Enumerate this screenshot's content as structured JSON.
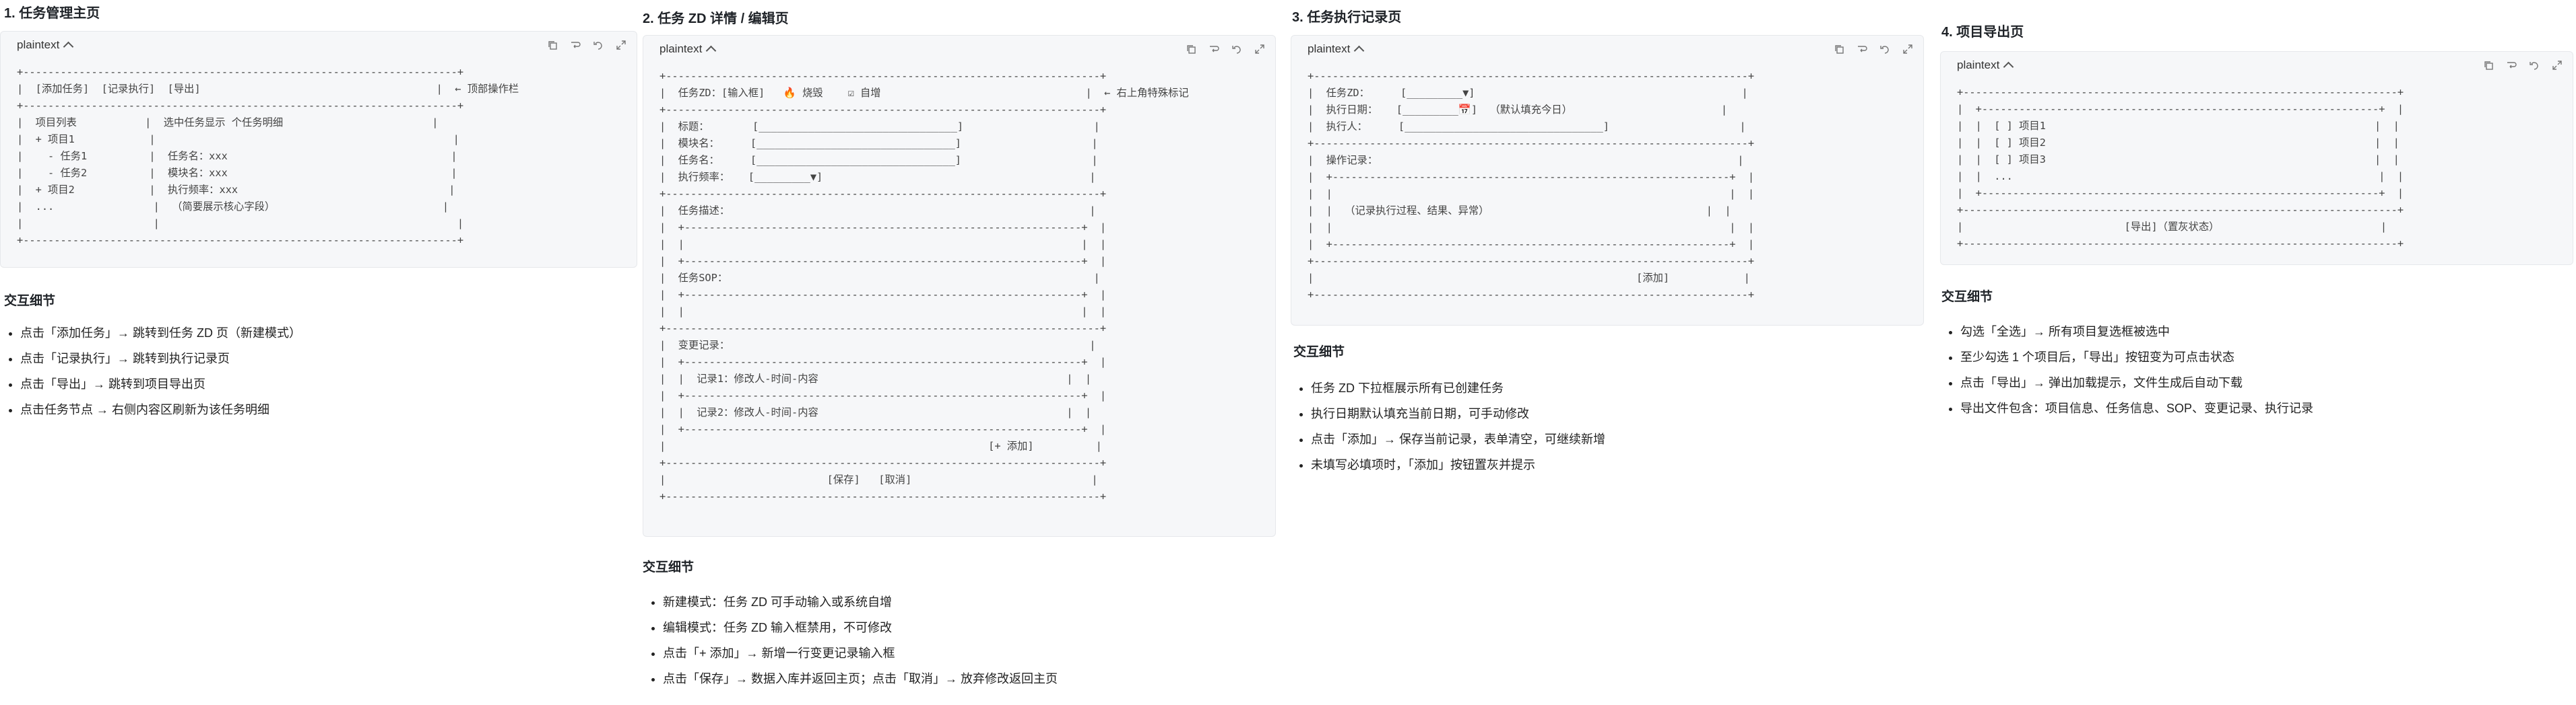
{
  "sections": [
    {
      "title": "1. 任务管理主页",
      "lang": "plaintext",
      "code": "+----------------------------------------------------------------------+\n|  [添加任务]  [记录执行]  [导出]                                      |  ← 顶部操作栏\n+----------------------------------------------------------------------+\n|  项目列表           |  选中任务显示 个任务明细                        |\n|  + 项目1            |                                                |\n|    - 任务1          |  任务名：xxx                                    |\n|    - 任务2          |  模块名：xxx                                    |\n|  + 项目2            |  执行频率：xxx                                  |\n|  ...                |  （简要展示核心字段）                           |\n|                     |                                                |\n+----------------------------------------------------------------------+",
      "detail_label": "交互细节",
      "details": [
        "点击「添加任务」→ 跳转到任务 ZD 页（新建模式）",
        "点击「记录执行」→ 跳转到执行记录页",
        "点击「导出」→ 跳转到项目导出页",
        "点击任务节点 → 右侧内容区刷新为该任务明细"
      ]
    },
    {
      "title": "2. 任务 ZD 详情 / 编辑页",
      "lang": "plaintext",
      "code": "+----------------------------------------------------------------------+\n|  任务ZD：[输入框]   🔥 烧毁    ☑ 自增                                 |  ← 右上角特殊标记\n+----------------------------------------------------------------------+\n|  标题：       [________________________________]                     |\n|  模块名：     [________________________________]                     |\n|  任务名：     [________________________________]                     |\n|  执行频率：   [_________▼]                                           |\n+----------------------------------------------------------------------+\n|  任务描述：                                                          |\n|  +----------------------------------------------------------------+  |\n|  |                                                                |  |\n|  +----------------------------------------------------------------+  |\n|  任务SOP：                                                           |\n|  +----------------------------------------------------------------+  |\n|  |                                                                |  |\n+----------------------------------------------------------------------+\n|  变更记录：                                                          |\n|  +----------------------------------------------------------------+  |\n|  |  记录1：修改人-时间-内容                                        |  |\n|  +----------------------------------------------------------------+  |\n|  |  记录2：修改人-时间-内容                                        |  |\n|  +----------------------------------------------------------------+  |\n|                                                    [+ 添加]          |\n+----------------------------------------------------------------------+\n|                          [保存]   [取消]                             |\n+----------------------------------------------------------------------+",
      "detail_label": "交互细节",
      "details": [
        "新建模式：任务 ZD 可手动输入或系统自增",
        "编辑模式：任务 ZD 输入框禁用，不可修改",
        "点击「+ 添加」→ 新增一行变更记录输入框",
        "点击「保存」→ 数据入库并返回主页；点击「取消」→ 放弃修改返回主页"
      ]
    },
    {
      "title": "3. 任务执行记录页",
      "lang": "plaintext",
      "code": "+----------------------------------------------------------------------+\n|  任务ZD：     [_________▼]                                           |\n|  执行日期：   [_________📅]  （默认填充今日）                        |\n|  执行人：     [________________________________]                     |\n+----------------------------------------------------------------------+\n|  操作记录：                                                          |\n|  +----------------------------------------------------------------+  |\n|  |                                                                |  |\n|  |  （记录执行过程、结果、异常）                                   |  |\n|  |                                                                |  |\n|  +----------------------------------------------------------------+  |\n+----------------------------------------------------------------------+\n|                                                    [添加]            |\n+----------------------------------------------------------------------+",
      "detail_label": "交互细节",
      "details": [
        "任务 ZD 下拉框展示所有已创建任务",
        "执行日期默认填充当前日期，可手动修改",
        "点击「添加」→ 保存当前记录，表单清空，可继续新增",
        "未填写必填项时，「添加」按钮置灰并提示"
      ]
    },
    {
      "title": "4. 项目导出页",
      "lang": "plaintext",
      "code": "+----------------------------------------------------------------------+\n|  +----------------------------------------------------------------+  |\n|  |  [ ] 项目1                                                     |  |\n|  |  [ ] 项目2                                                     |  |\n|  |  [ ] 项目3                                                     |  |\n|  |  ...                                                           |  |\n|  +----------------------------------------------------------------+  |\n+----------------------------------------------------------------------+\n|                          [导出]（置灰状态）                          |\n+----------------------------------------------------------------------+",
      "detail_label": "交互细节",
      "details": [
        "勾选「全选」→ 所有项目复选框被选中",
        "至少勾选 1 个项目后，「导出」按钮变为可点击状态",
        "点击「导出」→ 弹出加载提示，文件生成后自动下载",
        "导出文件包含：项目信息、任务信息、SOP、变更记录、执行记录"
      ]
    }
  ],
  "icons": [
    "copy-icon",
    "wrap-icon",
    "undo-icon",
    "expand-icon"
  ]
}
